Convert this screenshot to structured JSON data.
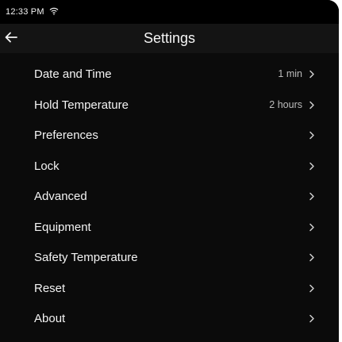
{
  "status": {
    "time": "12:33 PM",
    "wifi_icon": "wifi-icon"
  },
  "header": {
    "title": "Settings",
    "back_icon": "back-arrow-icon"
  },
  "settings": [
    {
      "label": "Date and Time",
      "value": "1 min"
    },
    {
      "label": "Hold Temperature",
      "value": "2 hours"
    },
    {
      "label": "Preferences",
      "value": ""
    },
    {
      "label": "Lock",
      "value": ""
    },
    {
      "label": "Advanced",
      "value": ""
    },
    {
      "label": "Equipment",
      "value": ""
    },
    {
      "label": "Safety Temperature",
      "value": ""
    },
    {
      "label": "Reset",
      "value": ""
    },
    {
      "label": "About",
      "value": ""
    }
  ],
  "colors": {
    "background": "#0b0b0b",
    "header": "#141414",
    "text": "#f3f3f3",
    "secondary_text": "#bdbdbd"
  }
}
